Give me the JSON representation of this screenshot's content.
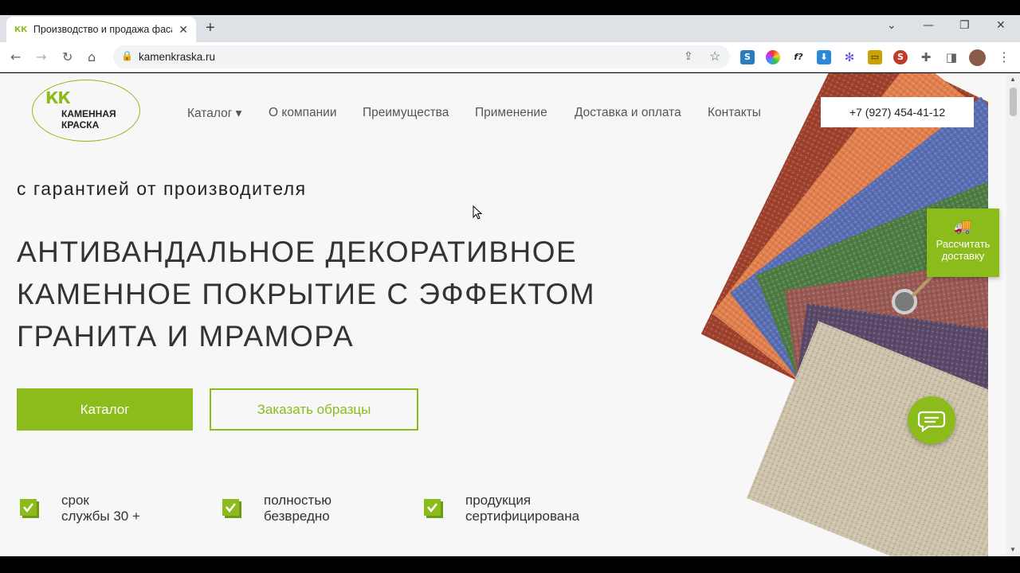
{
  "browser": {
    "tab_title": "Производство и продажа фасад",
    "tab_favicon": "КК",
    "tab_close": "✕",
    "new_tab": "+",
    "url": "kamenkraska.ru",
    "window_controls": {
      "dropdown": "⌄",
      "minimize": "—",
      "restore": "❐",
      "close": "✕"
    },
    "nav": {
      "back": "←",
      "forward": "→",
      "reload": "↻",
      "home": "⌂"
    }
  },
  "header": {
    "logo": {
      "mark": "КК",
      "line1": "КАМЕННАЯ",
      "line2": "КРАСКА"
    },
    "nav_items": [
      {
        "label": "Каталог ▾"
      },
      {
        "label": "О компании"
      },
      {
        "label": "Преимущества"
      },
      {
        "label": "Применение"
      },
      {
        "label": "Доставка и оплата"
      },
      {
        "label": "Контакты"
      }
    ],
    "phone": "+7 (927) 454-41-12"
  },
  "hero": {
    "subtitle": "с гарантией от производителя",
    "headline_lines": [
      "АНТИВАНДАЛЬНОЕ ДЕКОРАТИВНОЕ",
      "КАМЕННОЕ ПОКРЫТИЕ С ЭФФЕКТОМ",
      "ГРАНИТА И МРАМОРА"
    ],
    "catalog_button": "Каталог",
    "samples_button": "Заказать образцы"
  },
  "features": [
    {
      "line1": "срок",
      "line2": "службы 30 +"
    },
    {
      "line1": "полностью",
      "line2": "безвредно"
    },
    {
      "line1": "продукция",
      "line2": "сертифицирована"
    }
  ],
  "widgets": {
    "delivery_line1": "Рассчитать",
    "delivery_line2": "доставку"
  },
  "colors": {
    "accent": "#8cbc1b",
    "swatches": [
      "#a0432e",
      "#e2804e",
      "#5b6fb4",
      "#4f7e45",
      "#9a5a55",
      "#5b4a6a",
      "#cfc3ac"
    ]
  }
}
